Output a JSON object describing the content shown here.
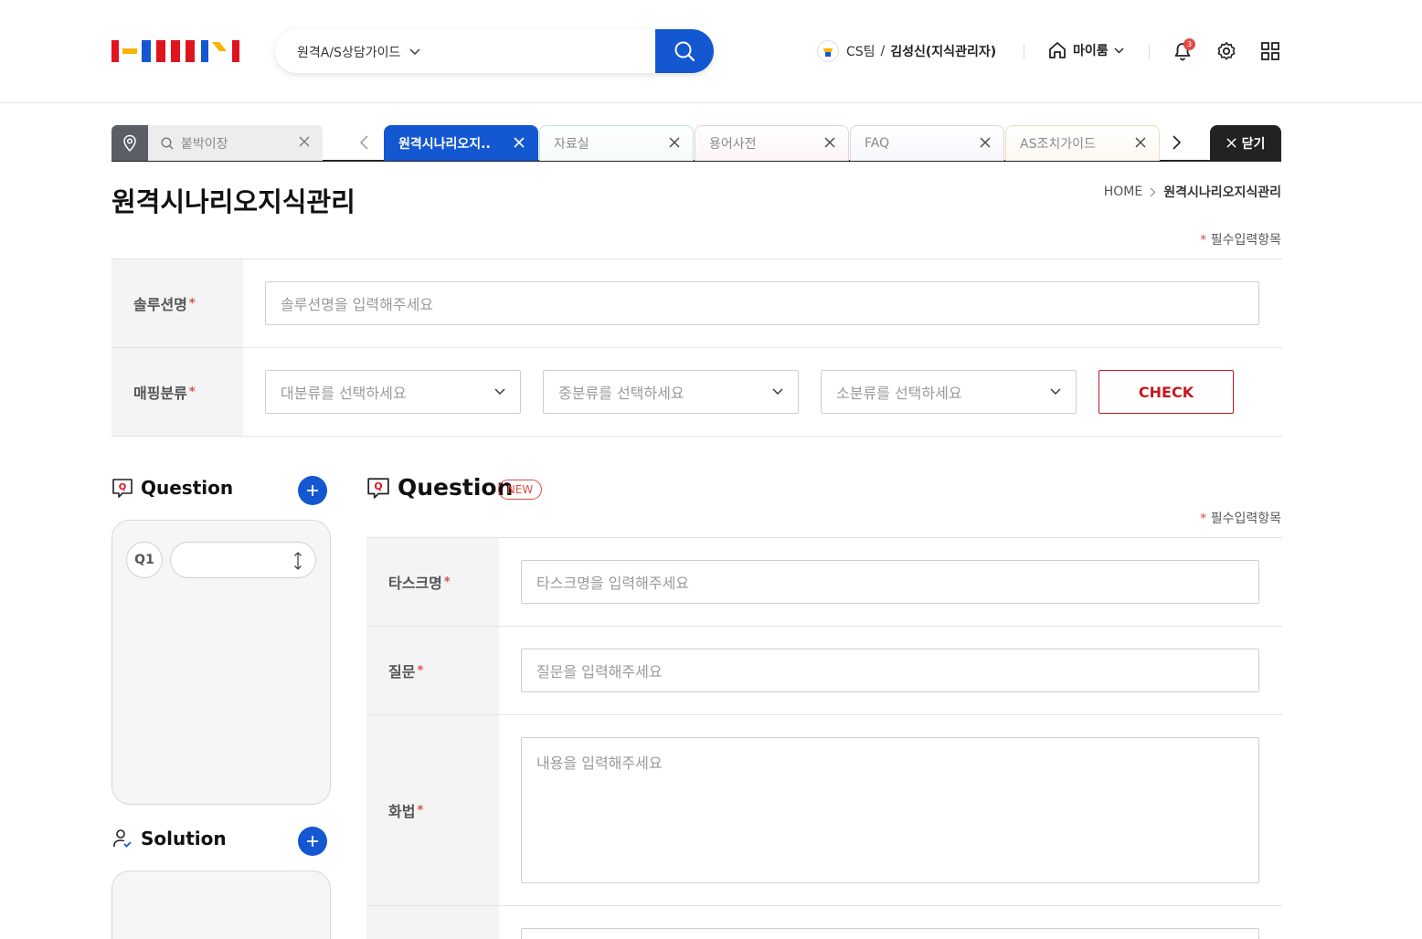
{
  "header": {
    "search_select": "원격A/S상담가이드",
    "user": {
      "team": "CS팀",
      "separator": "/",
      "name": "김성신(지식관리자)"
    },
    "myroom_label": "마이룸",
    "notification_count": "3"
  },
  "tabs": {
    "pinned_search_placeholder": "붙박이장",
    "items": [
      {
        "label": "원격시나리오지..",
        "active": true,
        "color": "#1357d1"
      },
      {
        "label": "자료실",
        "active": false,
        "color": "#bfe6d8"
      },
      {
        "label": "용어사전",
        "active": false,
        "color": "#f1cfd3"
      },
      {
        "label": "FAQ",
        "active": false,
        "color": "#d8d4ee"
      },
      {
        "label": "AS조치가이드",
        "active": false,
        "color": "#f3dcb6"
      }
    ],
    "close_all_label": "닫기"
  },
  "page": {
    "title": "원격시나리오지식관리",
    "breadcrumb_home": "HOME",
    "breadcrumb_current": "원격시나리오지식관리",
    "required_note": "필수입력항목",
    "required_star": "*"
  },
  "top_form": {
    "solution_label": "솔루션명",
    "solution_placeholder": "솔루션명을 입력해주세요",
    "mapping_label": "매핑분류",
    "major_placeholder": "대분류를 선택하세요",
    "middle_placeholder": "중분류를 선택하세요",
    "minor_placeholder": "소분류를 선택하세요",
    "check_label": "CHECK"
  },
  "left_panel": {
    "question_title": "Question",
    "question_chip": "Q1",
    "solution_title": "Solution"
  },
  "question_form": {
    "title": "Question",
    "badge": "NEW",
    "task_label": "타스크명",
    "task_placeholder": "타스크명을 입력해주세요",
    "question_label": "질문",
    "question_placeholder": "질문을 입력해주세요",
    "script_label": "화법",
    "script_placeholder": "내용을 입력해주세요"
  },
  "colors": {
    "primary": "#1357d1",
    "accent_red": "#c8161d",
    "required_star": "#e24a4a"
  }
}
